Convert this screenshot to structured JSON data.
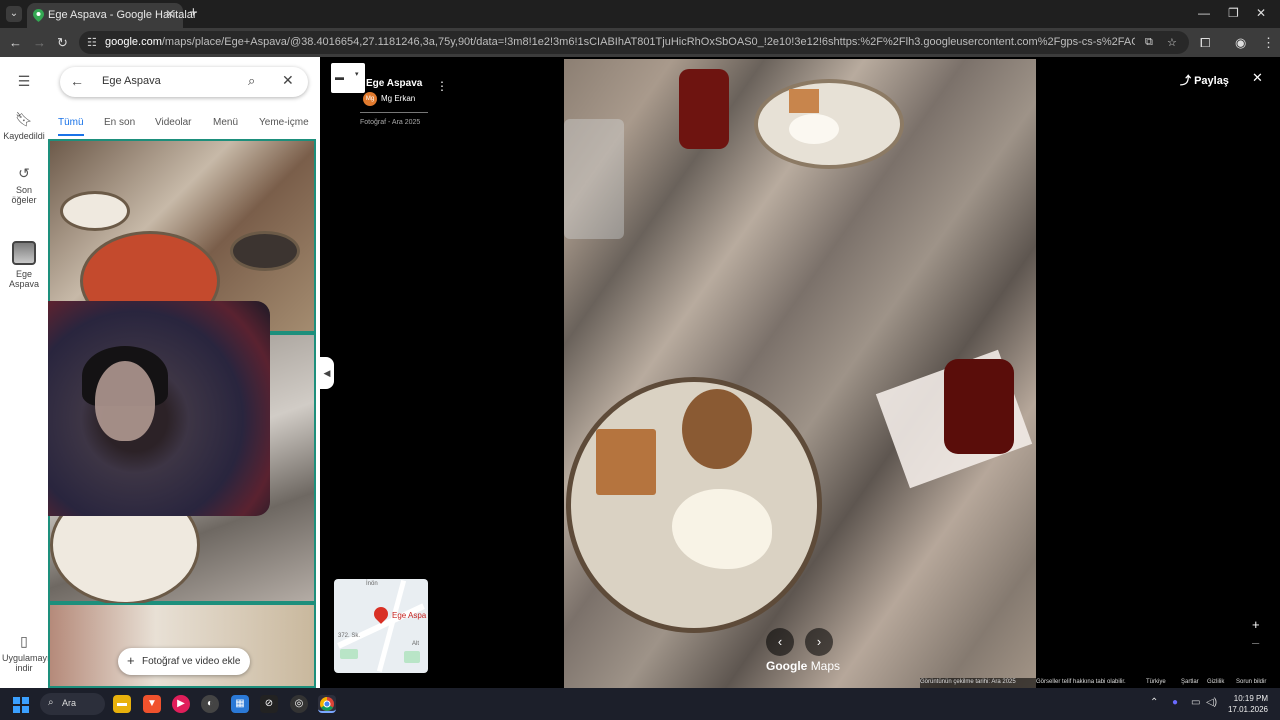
{
  "browser": {
    "tab_title": "Ege Aspava - Google Haritalar",
    "url_host": "google.com",
    "url_rest": "/maps/place/Ege+Aspava/@38.4016654,27.1181246,3a,75y,90t/data=!3m8!1e2!3m6!1sCIABIhAT801TjuHicRhOxSbOAS0_!2e10!3e12!6shttps:%2F%2Flh3.googleusercontent.com%2Fgps-cs-s%2FAG0ilSwHNuqH_mqos_6rGZmzg7CwSbFGeQ..."
  },
  "rail": {
    "saved": "Kaydedildi",
    "recent": "Son öğeler",
    "place": "Ege Aspava",
    "download": "Uygulamayı indir"
  },
  "panel": {
    "search_query": "Ege Aspava",
    "tabs": [
      "Tümü",
      "En son",
      "Videolar",
      "Menü",
      "Yeme-içme"
    ],
    "add_button": "Fotoğraf ve video ekle"
  },
  "viewer": {
    "place_title": "Ege Aspava",
    "author_initials": "Mg",
    "author": "Mg Erkan",
    "photo_meta": "Fotoğraf - Ara 2025",
    "share": "Paylaş",
    "logo_google": "Google",
    "logo_maps": "Maps",
    "minimap_label": "Ege Aspa",
    "minimap_streets": [
      "İnön",
      "372. Sk.",
      "Alt"
    ],
    "footer": {
      "capture_date": "Görüntünün çekilme tarihi: Ara 2025",
      "copyright": "Görseller telif hakkına tabi olabilir.",
      "region": "Türkiye",
      "terms": "Şartlar",
      "privacy": "Gizlilik",
      "report": "Sorun bildir"
    }
  },
  "taskbar": {
    "search": "Ara",
    "time": "10:19 PM",
    "date": "17.01.2026"
  }
}
